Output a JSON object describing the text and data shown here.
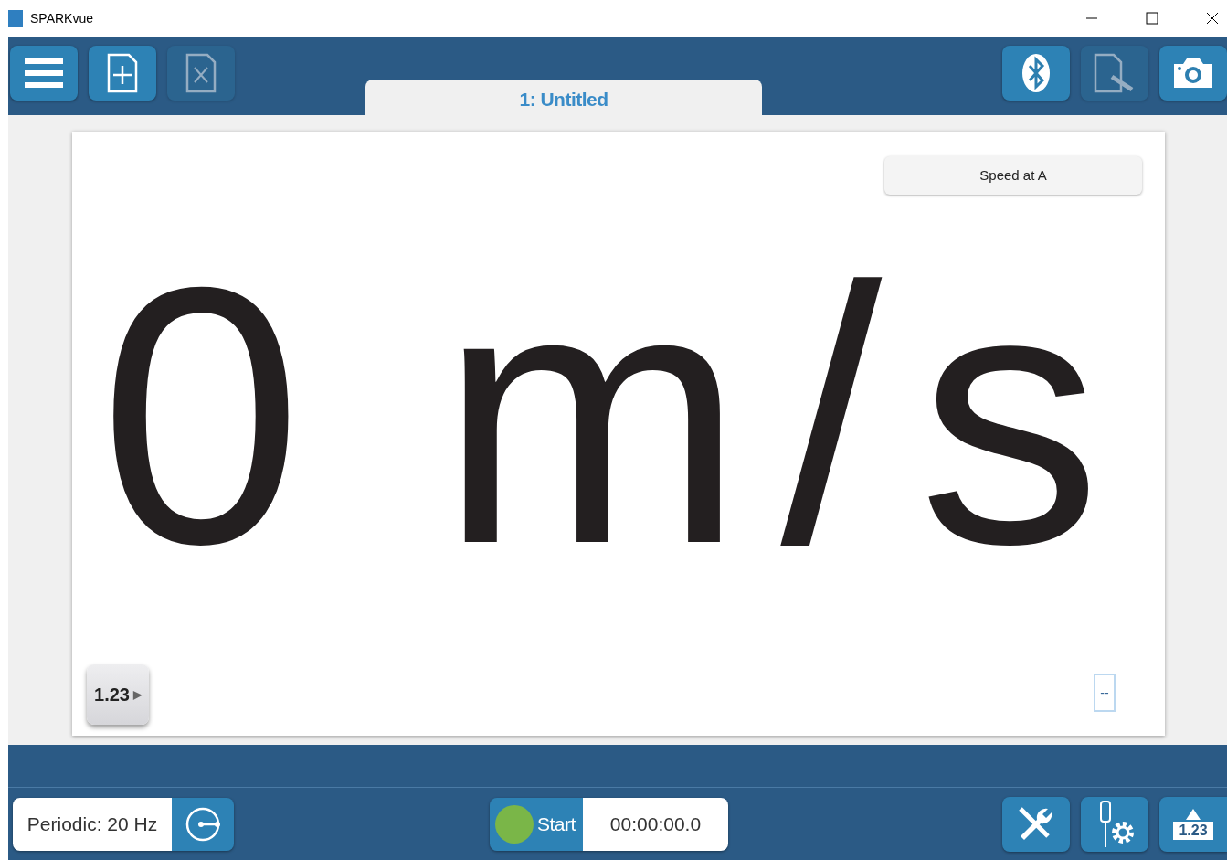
{
  "window": {
    "title": "SPARKvue"
  },
  "toolbar_left": [
    {
      "kind": "menu",
      "disabled": false
    },
    {
      "kind": "new",
      "disabled": false
    },
    {
      "kind": "delete",
      "disabled": true
    }
  ],
  "toolbar_right": [
    {
      "kind": "bluetooth",
      "disabled": false
    },
    {
      "kind": "journal",
      "disabled": true
    },
    {
      "kind": "camera",
      "disabled": false
    }
  ],
  "tabs": [
    {
      "label": "1: Untitled",
      "selected": true
    }
  ],
  "display": {
    "measurement": "Speed at A",
    "value": "0",
    "unit": "m/s",
    "format_button": "1.23",
    "format_arrow": "▶",
    "scale_label": "--"
  },
  "bottom": {
    "sampling": "Periodic: 20 Hz",
    "start": "Start",
    "timer": "00:00:00.0",
    "recording": false,
    "digits_label": "1.23"
  }
}
